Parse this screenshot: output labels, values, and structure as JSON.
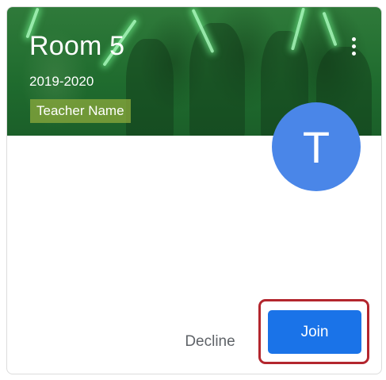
{
  "card": {
    "title": "Room 5",
    "subtitle": "2019-2020",
    "teacher": "Teacher Name",
    "avatar_letter": "T",
    "more_icon": "more-vert-icon",
    "decline_label": "Decline",
    "join_label": "Join"
  },
  "colors": {
    "banner": "#1f6b2e",
    "avatar": "#4a86e8",
    "join_button": "#1a73e8",
    "decline_text": "#5f6368",
    "highlight": "#b3262e"
  }
}
